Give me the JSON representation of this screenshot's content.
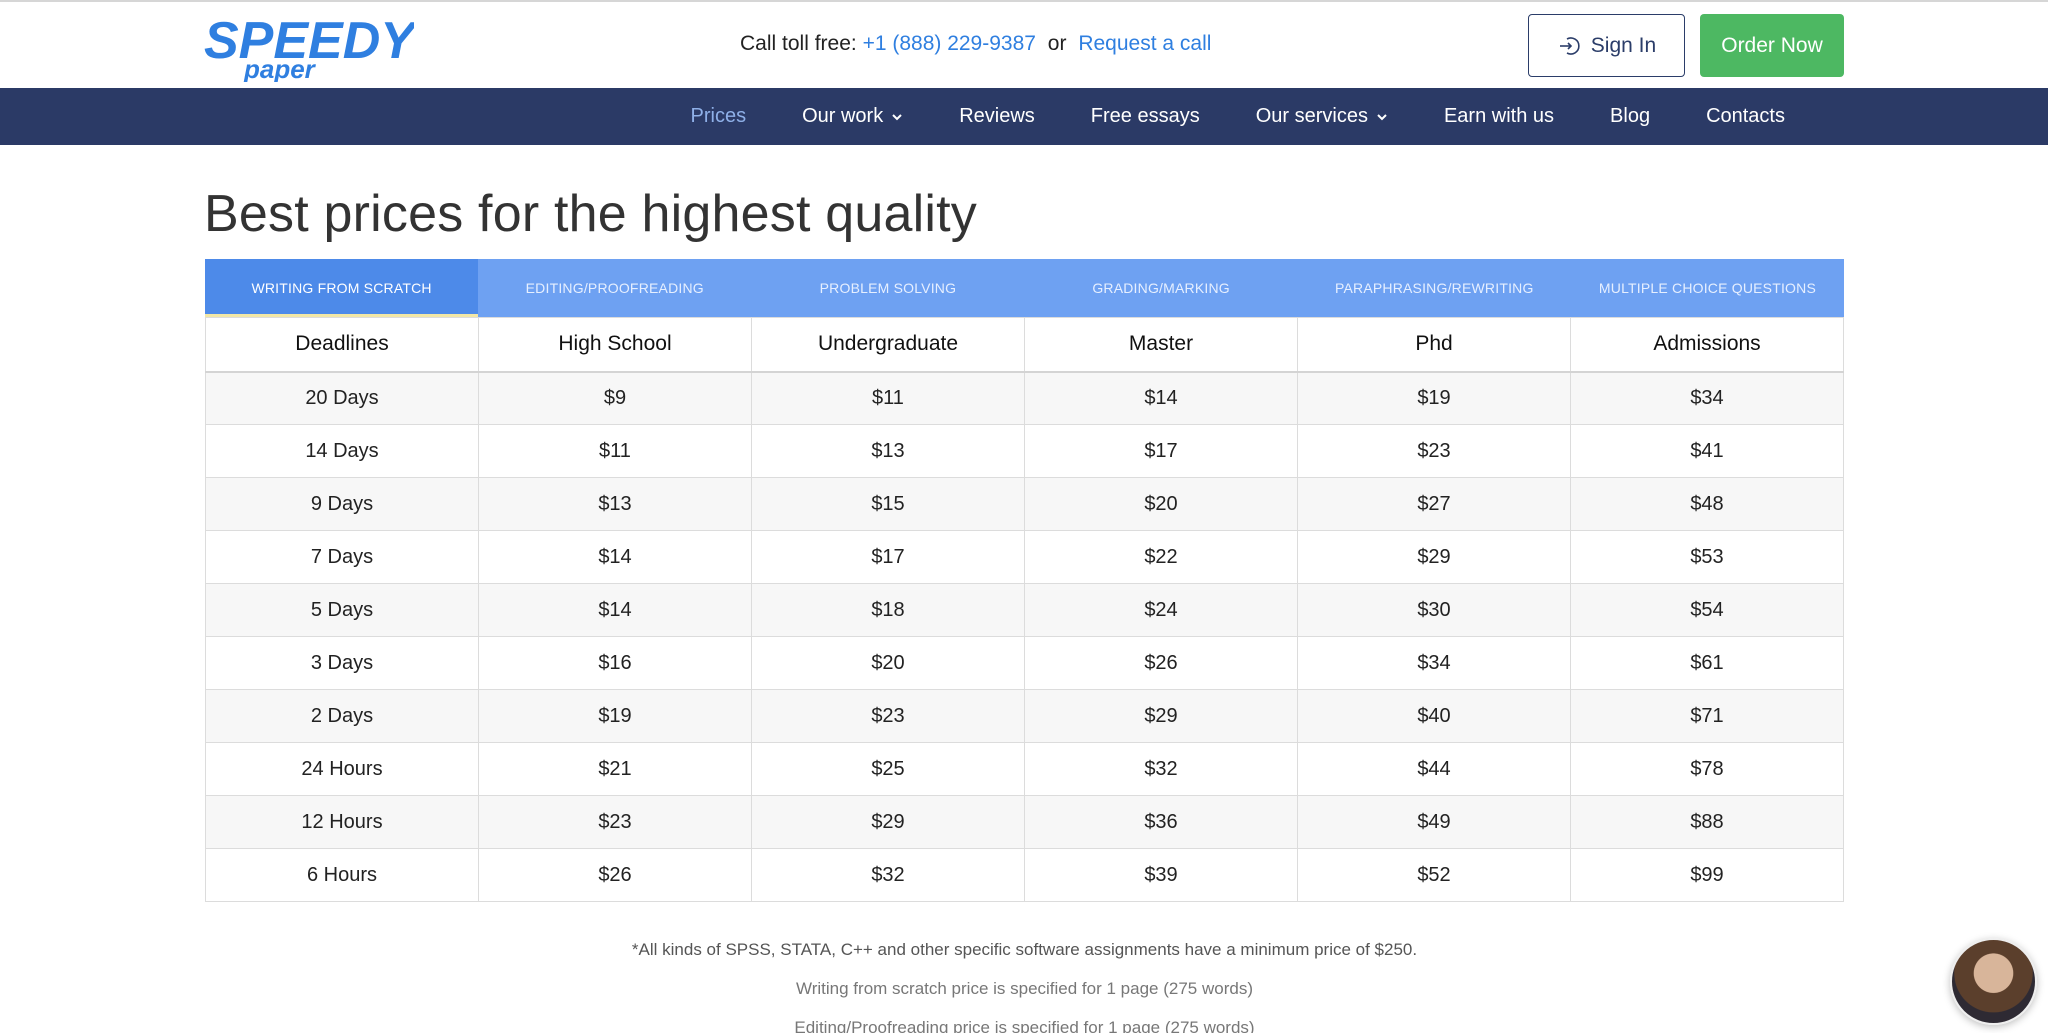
{
  "header": {
    "logo_text_main": "SPEEDY",
    "logo_text_sub": "paper",
    "contact_prefix": "Call toll free:",
    "phone": "+1 (888) 229-9387",
    "or_text": "or",
    "request_call": "Request a call",
    "sign_in": "Sign In",
    "order_now": "Order Now"
  },
  "nav": {
    "items": [
      {
        "label": "Prices",
        "active": true,
        "dropdown": false
      },
      {
        "label": "Our work",
        "active": false,
        "dropdown": true
      },
      {
        "label": "Reviews",
        "active": false,
        "dropdown": false
      },
      {
        "label": "Free essays",
        "active": false,
        "dropdown": false
      },
      {
        "label": "Our services",
        "active": false,
        "dropdown": true
      },
      {
        "label": "Earn with us",
        "active": false,
        "dropdown": false
      },
      {
        "label": "Blog",
        "active": false,
        "dropdown": false
      },
      {
        "label": "Contacts",
        "active": false,
        "dropdown": false
      }
    ]
  },
  "main": {
    "title": "Best prices for the highest quality",
    "tabs": [
      {
        "label": "Writing from scratch",
        "active": true
      },
      {
        "label": "Editing/Proofreading",
        "active": false
      },
      {
        "label": "Problem solving",
        "active": false
      },
      {
        "label": "Grading/Marking",
        "active": false
      },
      {
        "label": "Paraphrasing/Rewriting",
        "active": false
      },
      {
        "label": "Multiple choice questions",
        "active": false
      }
    ],
    "table": {
      "columns": [
        "Deadlines",
        "High School",
        "Undergraduate",
        "Master",
        "Phd",
        "Admissions"
      ],
      "rows": [
        [
          "20 Days",
          "$9",
          "$11",
          "$14",
          "$19",
          "$34"
        ],
        [
          "14 Days",
          "$11",
          "$13",
          "$17",
          "$23",
          "$41"
        ],
        [
          "9 Days",
          "$13",
          "$15",
          "$20",
          "$27",
          "$48"
        ],
        [
          "7 Days",
          "$14",
          "$17",
          "$22",
          "$29",
          "$53"
        ],
        [
          "5 Days",
          "$14",
          "$18",
          "$24",
          "$30",
          "$54"
        ],
        [
          "3 Days",
          "$16",
          "$20",
          "$26",
          "$34",
          "$61"
        ],
        [
          "2 Days",
          "$19",
          "$23",
          "$29",
          "$40",
          "$71"
        ],
        [
          "24 Hours",
          "$21",
          "$25",
          "$32",
          "$44",
          "$78"
        ],
        [
          "12 Hours",
          "$23",
          "$29",
          "$36",
          "$49",
          "$88"
        ],
        [
          "6 Hours",
          "$26",
          "$32",
          "$39",
          "$52",
          "$99"
        ]
      ]
    },
    "notes": [
      "*All kinds of SPSS, STATA, C++ and other specific software assignments have a minimum price of $250.",
      "Writing from scratch price is specified for 1 page (275 words)",
      "Editing/Proofreading price is specified for 1 page (275 words)"
    ]
  },
  "colors": {
    "brand_blue": "#2f7fe0",
    "nav_bg": "#2b3a66",
    "tabs_bg": "#6ea1f2",
    "order_green": "#4db862"
  },
  "icons": {
    "sign_in": "login-icon",
    "dropdown": "chevron-down-icon",
    "chat": "support-avatar"
  }
}
